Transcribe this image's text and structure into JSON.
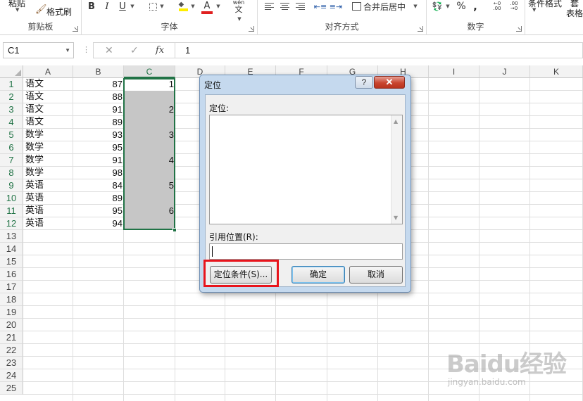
{
  "ribbon": {
    "clipboard": {
      "paste_label": "粘贴",
      "format_painter_label": "格式刷",
      "group_label": "剪贴板"
    },
    "font": {
      "bold_label": "B",
      "italic_label": "I",
      "underline_label": "U",
      "wen_label": "wén",
      "wen_char": "文",
      "color_a": "A",
      "group_label": "字体"
    },
    "alignment": {
      "merge_label": "合并后居中",
      "group_label": "对齐方式"
    },
    "number": {
      "percent_label": "%",
      "comma_label": ",",
      "group_label": "数字"
    },
    "styles": {
      "conditional_label": "条件格式",
      "table_label": "表格",
      "extra_label": "套"
    }
  },
  "formula_bar": {
    "cell_ref": "C1",
    "cancel_symbol": "✕",
    "enter_symbol": "✓",
    "fx_symbol": "fx",
    "content": "1"
  },
  "sheet": {
    "columns": [
      "A",
      "B",
      "C",
      "D",
      "E",
      "F",
      "G",
      "H",
      "I",
      "J",
      "K"
    ],
    "row_numbers": [
      "1",
      "2",
      "3",
      "4",
      "5",
      "6",
      "7",
      "8",
      "9",
      "10",
      "11",
      "12",
      "13",
      "14",
      "15",
      "16",
      "17",
      "18",
      "19",
      "20",
      "21",
      "22",
      "23",
      "24",
      "25"
    ],
    "col_a": [
      "语文",
      "语文",
      "语文",
      "语文",
      "数学",
      "数学",
      "数学",
      "数学",
      "英语",
      "英语",
      "英语",
      "英语"
    ],
    "col_b": [
      "87",
      "88",
      "91",
      "89",
      "93",
      "95",
      "91",
      "98",
      "84",
      "89",
      "95",
      "94"
    ],
    "col_c": [
      "1",
      "",
      "2",
      "",
      "3",
      "",
      "4",
      "",
      "5",
      "",
      "6",
      ""
    ],
    "accent_color": "#217346"
  },
  "dialog": {
    "title": "定位",
    "help_symbol": "?",
    "close_symbol": "✕",
    "goto_label": "定位:",
    "reference_label": "引用位置(R):",
    "special_button": "定位条件(S)...",
    "ok_button": "确定",
    "cancel_button": "取消",
    "highlight_color": "#e8141c"
  },
  "watermark": {
    "logo": "Baidu经验",
    "url": "jingyan.baidu.com"
  }
}
